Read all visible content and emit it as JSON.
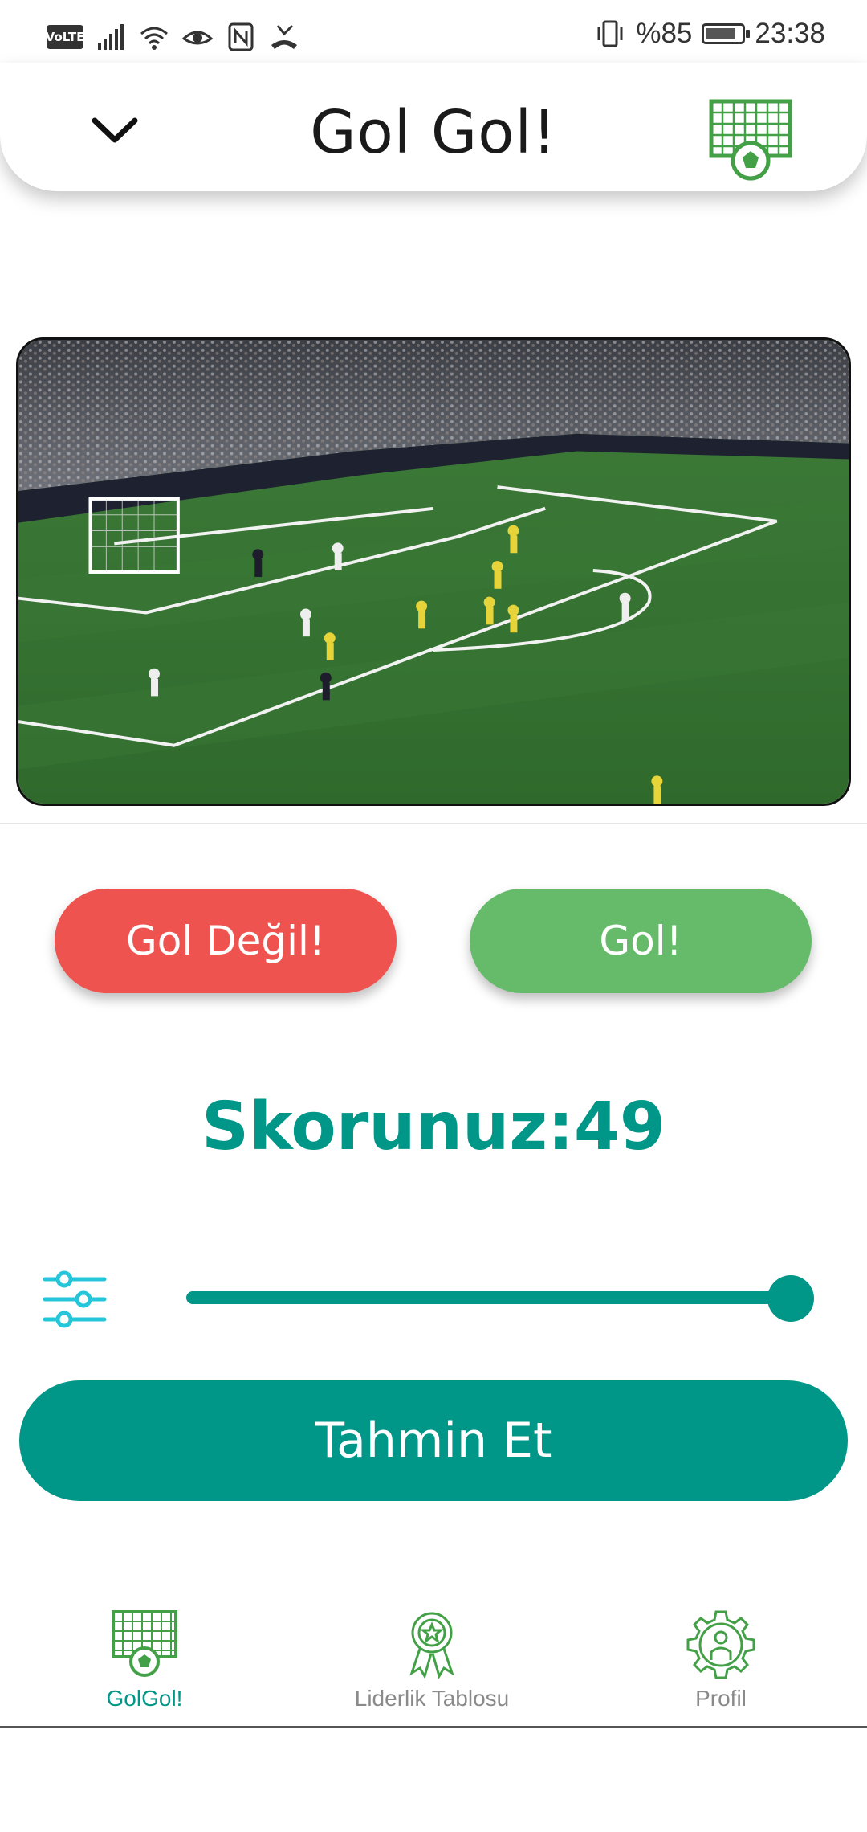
{
  "status_bar": {
    "volte": "VoLTE",
    "battery_text": "%85",
    "battery_level": 0.85,
    "time": "23:38",
    "icons": [
      "signal-icon",
      "wifi-icon",
      "eye-icon",
      "nfc-icon",
      "missed-call-icon",
      "vibrate-icon",
      "battery-icon"
    ]
  },
  "header": {
    "title": "Gol Gol!",
    "left_icon": "chevron-down-icon",
    "right_icon": "goal-net-icon"
  },
  "video": {
    "icon": "football-pitch-video"
  },
  "actions": {
    "not_goal_label": "Gol Değil!",
    "goal_label": "Gol!",
    "not_goal_color": "#ef5350",
    "goal_color": "#66bb6a"
  },
  "score": {
    "text": "Skorunuz:49"
  },
  "slider": {
    "icon": "sliders-icon",
    "value": 1.0,
    "color": "#009688"
  },
  "predict": {
    "label": "Tahmin Et",
    "color": "#009688"
  },
  "bottom_nav": {
    "items": [
      {
        "label": "GolGol!",
        "icon": "goal-net-icon",
        "active": true
      },
      {
        "label": "Liderlik Tablosu",
        "icon": "award-ribbon-icon",
        "active": false
      },
      {
        "label": "Profil",
        "icon": "profile-gear-icon",
        "active": false
      }
    ],
    "active_color": "#009688",
    "inactive_color": "#8a8a8a"
  }
}
